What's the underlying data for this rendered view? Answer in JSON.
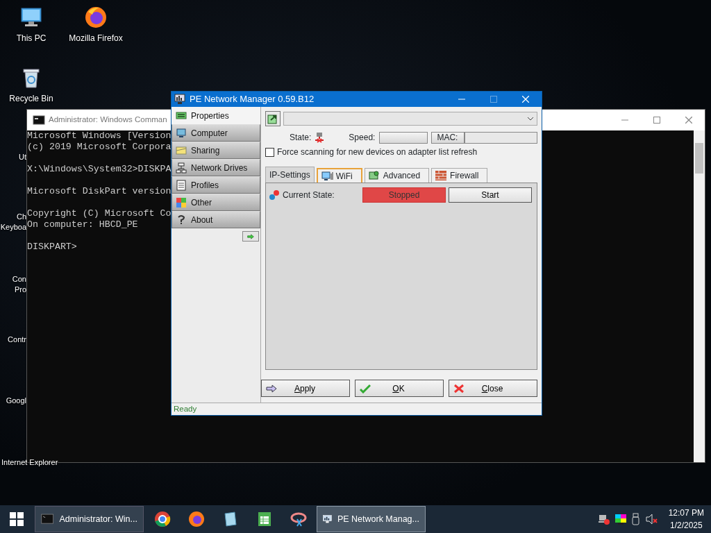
{
  "desktop_icons": [
    {
      "label": "This PC",
      "kind": "pc"
    },
    {
      "label": "Mozilla Firefox",
      "kind": "firefox"
    },
    {
      "label": "Recycle Bin",
      "kind": "recycle"
    }
  ],
  "desktop_labels_cut": [
    {
      "lines": [
        "Ut"
      ]
    },
    {
      "lines": [
        "Ch",
        "Keyboa"
      ]
    },
    {
      "lines": [
        "Con",
        "Pro"
      ]
    },
    {
      "lines": [
        "Contr"
      ]
    },
    {
      "lines": [
        "Googl"
      ]
    },
    {
      "lines": [
        "Internet Explorer"
      ]
    }
  ],
  "cmd_window": {
    "title": "Administrator: Windows Comman",
    "blocks": [
      [
        "Microsoft Windows [Version",
        "(c) 2019 Microsoft Corpora"
      ],
      [
        "X:\\Windows\\System32>DISKPA"
      ],
      [
        "Microsoft DiskPart version"
      ],
      [
        "Copyright (C) Microsoft Co",
        "On computer: HBCD_PE"
      ],
      [
        "DISKPART>"
      ]
    ]
  },
  "pe_window": {
    "title": "PE Network Manager 0.59.B12",
    "sidebar": [
      {
        "label": "Properties",
        "kind": "properties",
        "selected": true
      },
      {
        "label": "Computer",
        "kind": "computer",
        "selected": false
      },
      {
        "label": "Sharing",
        "kind": "sharing",
        "selected": false
      },
      {
        "label": "Network Drives",
        "kind": "drives",
        "selected": false
      },
      {
        "label": "Profiles",
        "kind": "profiles",
        "selected": false
      },
      {
        "label": "Other",
        "kind": "other",
        "selected": false
      },
      {
        "label": "About",
        "kind": "about",
        "selected": false
      }
    ],
    "state_label": "State:",
    "speed_label": "Speed:",
    "mac_label": "MAC:",
    "force_scan": {
      "label": "Force scanning for new devices on adapter list refresh",
      "checked": false
    },
    "tabs": [
      {
        "label": "IP-Settings",
        "kind": "ip",
        "selected": true,
        "hovered": false
      },
      {
        "label": "WiFi",
        "kind": "wifi",
        "selected": false,
        "hovered": true
      },
      {
        "label": "Advanced",
        "kind": "advanced",
        "selected": false,
        "hovered": false
      },
      {
        "label": "Firewall",
        "kind": "firewall",
        "selected": false,
        "hovered": false
      }
    ],
    "current_state": {
      "label": "Current State:",
      "value": "Stopped",
      "button": "Start"
    },
    "buttons": [
      {
        "label": "Apply",
        "underlined_first": true,
        "kind": "apply"
      },
      {
        "label": "OK",
        "underlined_first": true,
        "kind": "ok"
      },
      {
        "label": "Close",
        "underlined_first": true,
        "kind": "close"
      }
    ],
    "status": "Ready"
  },
  "taskbar": {
    "items": [
      {
        "label": "Administrator: Win...",
        "kind": "cmd",
        "active": false
      },
      {
        "kind": "chrome",
        "active": false
      },
      {
        "kind": "firefox",
        "active": false
      },
      {
        "kind": "notepad",
        "active": false
      },
      {
        "kind": "sheet",
        "active": false
      },
      {
        "kind": "tool",
        "active": false
      },
      {
        "label": "PE Network Manag...",
        "kind": "network",
        "active": true
      }
    ],
    "time": "12:07 PM",
    "date": "1/2/2025"
  }
}
